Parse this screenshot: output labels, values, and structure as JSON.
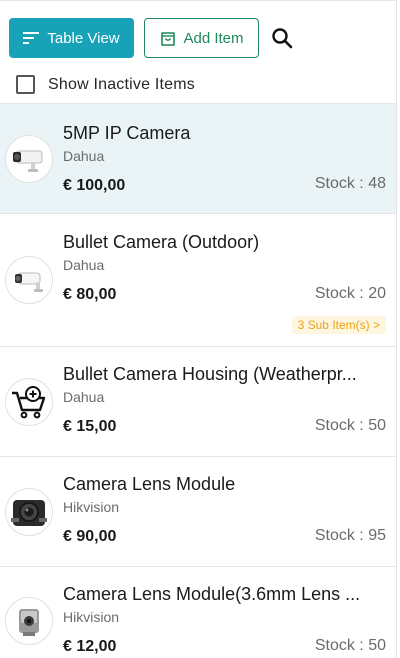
{
  "toolbar": {
    "table_view_label": "Table View",
    "add_item_label": "Add Item"
  },
  "filter": {
    "show_inactive_label": "Show Inactive Items",
    "show_inactive_checked": false
  },
  "items": [
    {
      "name": "5MP IP Camera",
      "brand": "Dahua",
      "price": "€ 100,00",
      "stock": "Stock : 48",
      "image": "bullet-camera-image",
      "selected": true
    },
    {
      "name": "Bullet Camera (Outdoor)",
      "brand": "Dahua",
      "price": "€ 80,00",
      "stock": "Stock : 20",
      "sub_items": "3 Sub Item(s) >",
      "image": "outdoor-camera-image"
    },
    {
      "name": "Bullet Camera Housing (Weatherpr...",
      "brand": "Dahua",
      "price": "€ 15,00",
      "stock": "Stock : 50",
      "image": "add-to-cart-placeholder-icon"
    },
    {
      "name": "Camera Lens Module",
      "brand": "Hikvision",
      "price": "€ 90,00",
      "stock": "Stock : 95",
      "image": "lens-module-image"
    },
    {
      "name": "Camera Lens Module(3.6mm Lens ...",
      "brand": "Hikvision",
      "price": "€ 12,00",
      "stock": "Stock : 50",
      "image": "small-lens-image"
    }
  ],
  "colors": {
    "primary": "#17a2b8",
    "outline": "#1f8a5b",
    "selected_row": "#eaf4f7",
    "badge": "#e8a317"
  }
}
